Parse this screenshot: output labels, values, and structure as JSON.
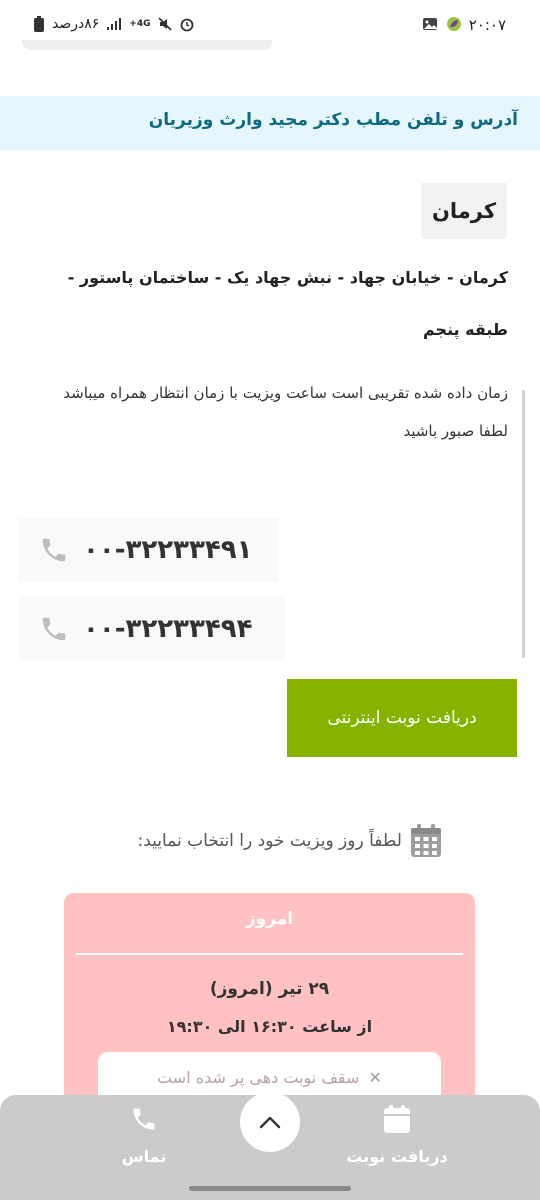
{
  "status_bar": {
    "time": "۲۰:۰۷",
    "battery_text": "۸۶درصد",
    "network": "4G+"
  },
  "page": {
    "title": "آدرس و تلفن مطب دکتر مجید وارث وزیریان",
    "city": "کرمان",
    "address": "کرمان - خیابان جهاد - نبش جهاد یک - ساختمان پاستور - طبقه پنجم",
    "note": "زمان داده شده تقریبی است ساعت ویزیت با زمان انتظار همراه میباشد لطفا صبور باشید"
  },
  "phones": [
    {
      "number": "۰۰-۳۲۲۳۳۴۹۱"
    },
    {
      "number": "۰۰-۳۲۲۳۳۴۹۴"
    }
  ],
  "booking_button": {
    "label": "دریافت نوبت اینترنتی"
  },
  "select_day": {
    "text": "لطفاً روز ویزیت خود را انتخاب نمایید:"
  },
  "day_card": {
    "title": "امروز",
    "date": "۲۹ تیر (امروز)",
    "hours": "از ساعت ۱۶:۳۰ الی ۱۹:۳۰",
    "status": "سقف نوبت دهی پر شده است",
    "color": "#ffc1c2"
  },
  "bottom_nav": {
    "contact_label": "تماس",
    "booking_label": "دریافت نوبت"
  },
  "colors": {
    "banner_bg": "#e5f6fc",
    "banner_text": "#0e6a82",
    "accent_green": "#86b300"
  }
}
